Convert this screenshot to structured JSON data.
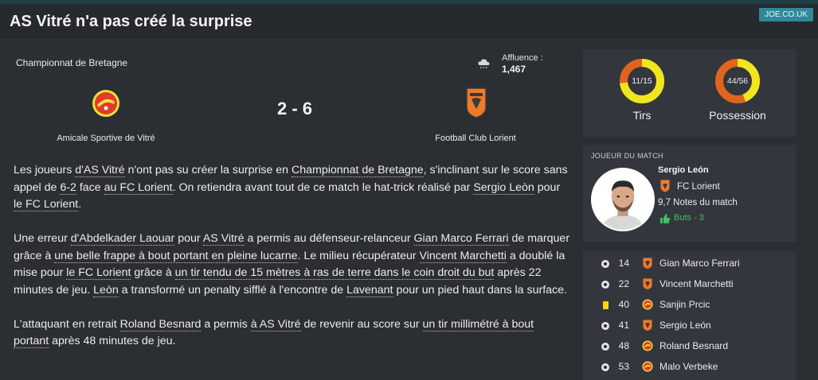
{
  "header": {
    "title": "AS Vitré n'a pas créé la surprise",
    "source": "JOE.CO.UK"
  },
  "match": {
    "competition": "Championnat de Bretagne",
    "attendance_label": "Affluence :",
    "attendance_value": "1,467",
    "score": "2 - 6",
    "home_team": "Amicale Sportive de Vitré",
    "away_team": "Football Club Lorient",
    "weather_icon": "rain-cloud-icon"
  },
  "article": {
    "paragraphs": [
      [
        {
          "t": "Les joueurs "
        },
        {
          "t": "d'AS Vitré",
          "link": true
        },
        {
          "t": " n'ont pas su créer la surprise en "
        },
        {
          "t": "Championnat de Bretagne",
          "link": true
        },
        {
          "t": ", s'inclinant sur le score sans appel de "
        },
        {
          "t": "6-2",
          "link": true
        },
        {
          "t": " face "
        },
        {
          "t": "au FC Lorient",
          "link": true
        },
        {
          "t": ". On retiendra avant tout de ce match le hat-trick réalisé par "
        },
        {
          "t": "Sergio Leòn",
          "link": true
        },
        {
          "t": " pour "
        },
        {
          "t": "le FC Lorient",
          "link": true
        },
        {
          "t": "."
        }
      ],
      [
        {
          "t": "Une erreur "
        },
        {
          "t": "d'Abdelkader Laouar",
          "link": true
        },
        {
          "t": " pour "
        },
        {
          "t": "AS Vitré",
          "link": true
        },
        {
          "t": " a permis au défenseur-relanceur "
        },
        {
          "t": "Gian Marco Ferrari",
          "link": true
        },
        {
          "t": " de marquer grâce à "
        },
        {
          "t": "une belle frappe à bout portant en pleine lucarne",
          "link": true
        },
        {
          "t": ". Le milieu récupérateur "
        },
        {
          "t": "Vincent Marchetti",
          "link": true
        },
        {
          "t": " a doublé la mise pour "
        },
        {
          "t": "le FC Lorient",
          "link": true
        },
        {
          "t": " grâce à "
        },
        {
          "t": "un tir tendu de 15 mètres à ras de terre dans le coin droit du but",
          "link": true
        },
        {
          "t": " après 22 minutes de jeu. "
        },
        {
          "t": "Leòn",
          "link": true
        },
        {
          "t": " a transformé un penalty sifflé à l'encontre de "
        },
        {
          "t": "Lavenant",
          "link": true
        },
        {
          "t": " pour un pied haut dans la surface."
        }
      ],
      [
        {
          "t": "L'attaquant en retrait "
        },
        {
          "t": "Roland Besnard",
          "link": true
        },
        {
          "t": " a permis "
        },
        {
          "t": "à AS Vitré",
          "link": true
        },
        {
          "t": " de revenir au score sur "
        },
        {
          "t": "un tir millimétré à bout portant",
          "link": true
        },
        {
          "t": " après 48 minutes de jeu."
        }
      ]
    ]
  },
  "stats": [
    {
      "label": "Tirs",
      "value": "11/15",
      "fraction": 0.733
    },
    {
      "label": "Possession",
      "value": "44/56",
      "fraction": 0.44
    }
  ],
  "colors": {
    "home": "#f0e61e",
    "away": "#e0641e",
    "accent": "#2e8a9a",
    "positive": "#3fbf5f"
  },
  "motm": {
    "title": "JOUEUR DU MATCH",
    "name": "Sergio León",
    "club": "FC Lorient",
    "rating": "9,7 Notes du match",
    "goals": "Buts - 3"
  },
  "events": [
    {
      "icon": "ball-icon",
      "minute": "14",
      "team": "away",
      "player": "Gian Marco Ferrari"
    },
    {
      "icon": "ball-icon",
      "minute": "22",
      "team": "away",
      "player": "Vincent Marchetti"
    },
    {
      "icon": "yellow-card-icon",
      "minute": "40",
      "team": "home",
      "player": "Sanjin Prcic"
    },
    {
      "icon": "ball-icon",
      "minute": "41",
      "team": "away",
      "player": "Sergio León"
    },
    {
      "icon": "ball-icon",
      "minute": "48",
      "team": "home",
      "player": "Roland Besnard"
    },
    {
      "icon": "ball-icon",
      "minute": "53",
      "team": "home",
      "player": "Malo Verbeke"
    }
  ]
}
